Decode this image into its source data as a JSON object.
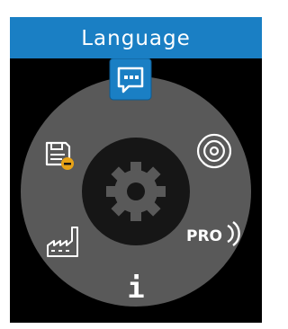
{
  "header": {
    "title": "Language"
  },
  "menu": {
    "selected_item": "language",
    "items": [
      {
        "id": "language",
        "icon": "speech-bubble-icon",
        "selected": true
      },
      {
        "id": "connectivity",
        "icon": "wireless-signal-icon",
        "selected": false
      },
      {
        "id": "pro",
        "icon": "pro-signal-icon",
        "label": "PRO",
        "selected": false
      },
      {
        "id": "info",
        "icon": "info-icon",
        "label": "i",
        "selected": false
      },
      {
        "id": "factory",
        "icon": "factory-icon",
        "selected": false
      },
      {
        "id": "storage",
        "icon": "save-remove-icon",
        "selected": false
      }
    ],
    "center_icon": "gear-icon"
  },
  "colors": {
    "title_bar": "#1a7fc4",
    "ring": "#595959",
    "center": "#161616",
    "selected": "#1a7fc4",
    "icon": "#ffffff",
    "badge": "#e8a317"
  }
}
